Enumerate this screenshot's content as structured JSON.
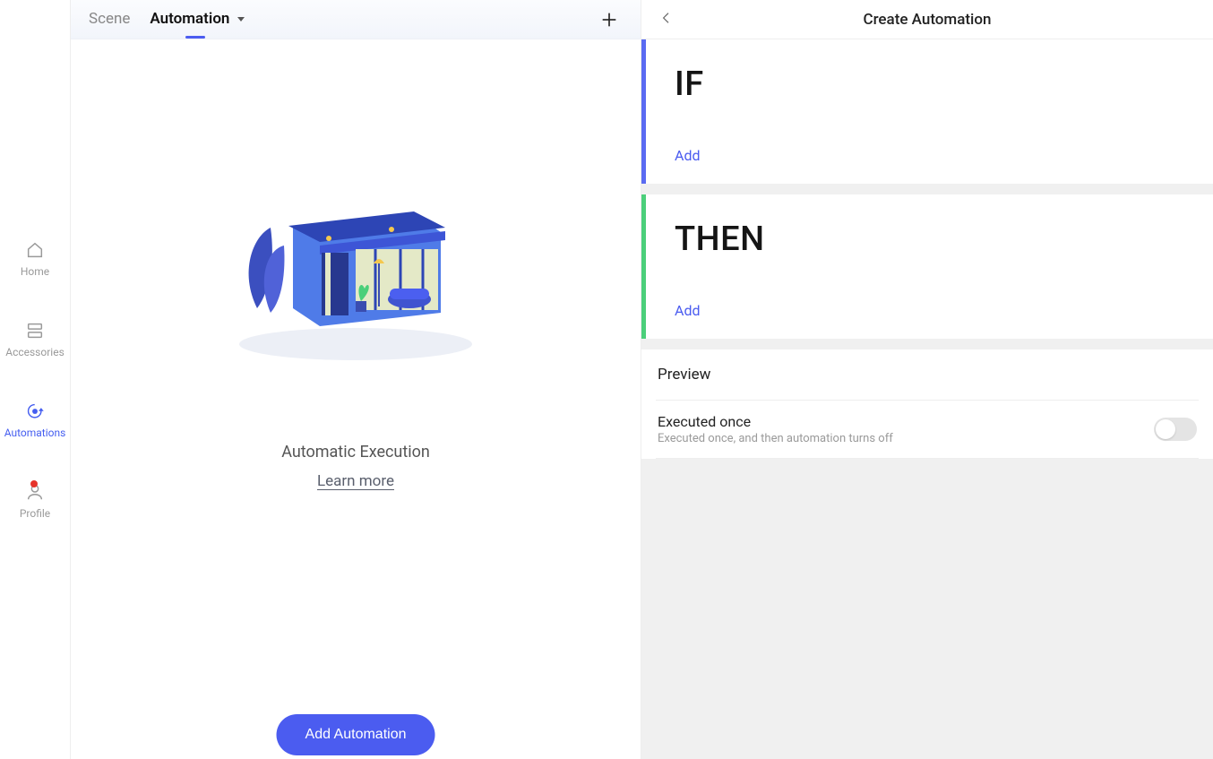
{
  "sidebar": {
    "items": [
      {
        "label": "Home"
      },
      {
        "label": "Accessories"
      },
      {
        "label": "Automations"
      },
      {
        "label": "Profile"
      }
    ],
    "active_index": 2,
    "profile_badge": true
  },
  "center": {
    "tabs": {
      "scene": "Scene",
      "automation": "Automation",
      "active": "automation"
    },
    "empty_state": {
      "title": "Automatic Execution",
      "learn_more": "Learn more"
    },
    "add_button": "Add Automation"
  },
  "right": {
    "title": "Create Automation",
    "if_section": {
      "heading": "IF",
      "add_label": "Add"
    },
    "then_section": {
      "heading": "THEN",
      "add_label": "Add"
    },
    "preview_label": "Preview",
    "executed_once": {
      "title": "Executed once",
      "subtitle": "Executed once, and then automation turns off",
      "enabled": false
    }
  }
}
